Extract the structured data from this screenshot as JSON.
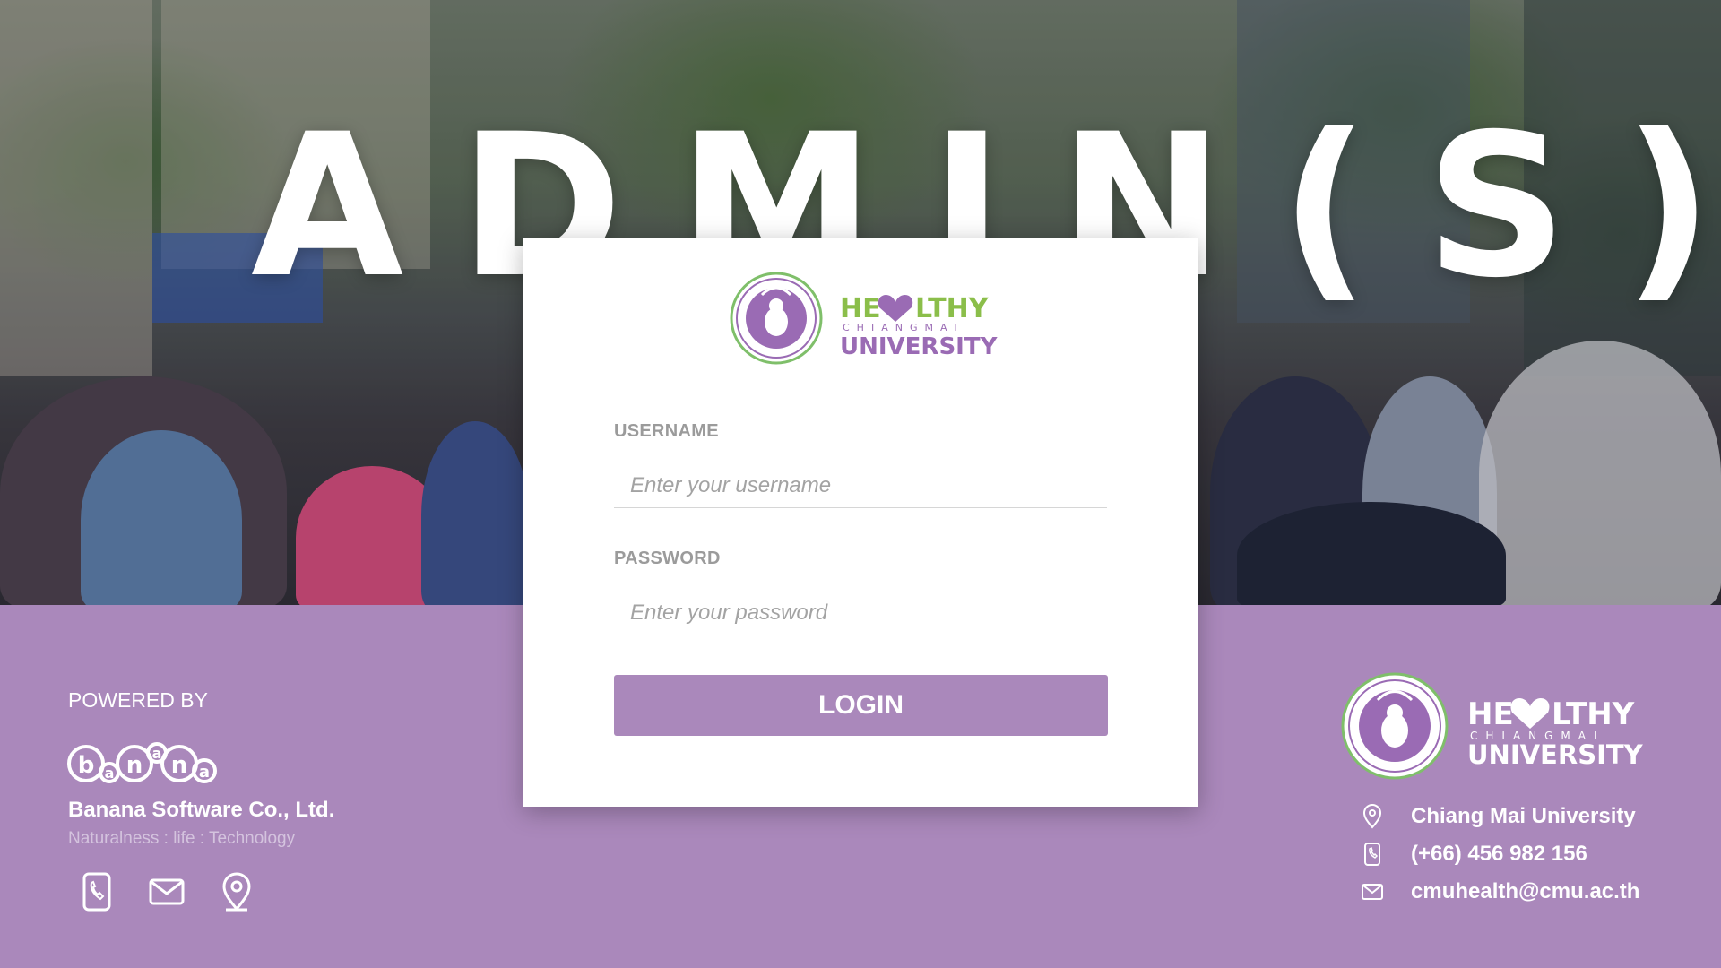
{
  "hero": {
    "title": "ADMIN(S)"
  },
  "brand": {
    "healthy_text": "HE LTHY",
    "healthy_sub": "CHIANGMAI",
    "healthy_univ": "UNIVERSITY",
    "seal_label": "Chiang Mai University seal",
    "colors": {
      "purple": "#aa88bb",
      "green": "#8bbe4a",
      "logo_purple": "#9a6bb4"
    }
  },
  "login": {
    "username_label": "USERNAME",
    "username_placeholder": "Enter your username",
    "password_label": "PASSWORD",
    "password_placeholder": "Enter your password",
    "button_label": "LOGIN"
  },
  "footer": {
    "powered_by": "POWERED BY",
    "banana_logo": "banana",
    "company_name": "Banana Software Co., Ltd.",
    "tagline": "Naturalness : life : Technology",
    "icons": [
      "phone-icon",
      "mail-icon",
      "location-icon"
    ],
    "contacts": [
      {
        "icon": "location-icon",
        "text": "Chiang Mai University"
      },
      {
        "icon": "phone-icon",
        "text": "(+66) 456 982 156"
      },
      {
        "icon": "mail-icon",
        "text": "cmuhealth@cmu.ac.th"
      }
    ]
  }
}
